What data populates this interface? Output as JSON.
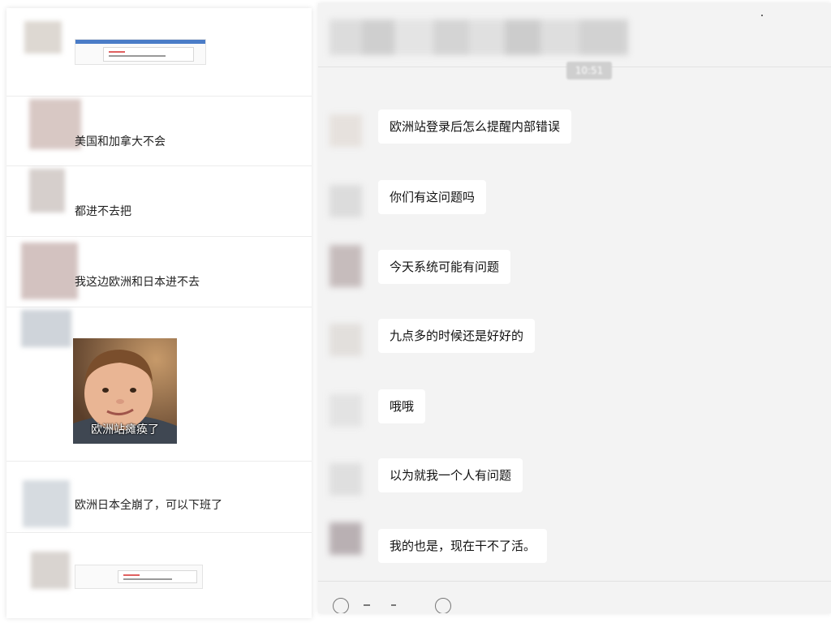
{
  "chat": {
    "time": "10:51",
    "messages": [
      {
        "text": "欧洲站登录后怎么提醒内部错误"
      },
      {
        "text": "你们有这问题吗"
      },
      {
        "text": "今天系统可能有问题"
      },
      {
        "text": "九点多的时候还是好好的"
      },
      {
        "text": "哦哦"
      },
      {
        "text": "以为就我一个人有问题"
      },
      {
        "text": "我的也是，现在干不了活。"
      }
    ]
  },
  "left_chat": {
    "items": [
      {
        "type": "screenshot"
      },
      {
        "type": "text",
        "text": "美国和加拿大不会"
      },
      {
        "type": "text",
        "text": "都进不去把"
      },
      {
        "type": "text",
        "text": "我这边欧洲和日本进不去"
      },
      {
        "type": "image",
        "caption": "欧洲站瘫痪了"
      },
      {
        "type": "text",
        "text": "欧洲日本全崩了，可以下班了"
      },
      {
        "type": "screenshot"
      }
    ]
  },
  "colors": {
    "chat_background": "#f3f3f3",
    "bubble": "#ffffff",
    "left_background": "#ffffff"
  },
  "icons": [
    "emoji-icon",
    "folder-icon",
    "scissors-icon",
    "chat-history-icon"
  ]
}
